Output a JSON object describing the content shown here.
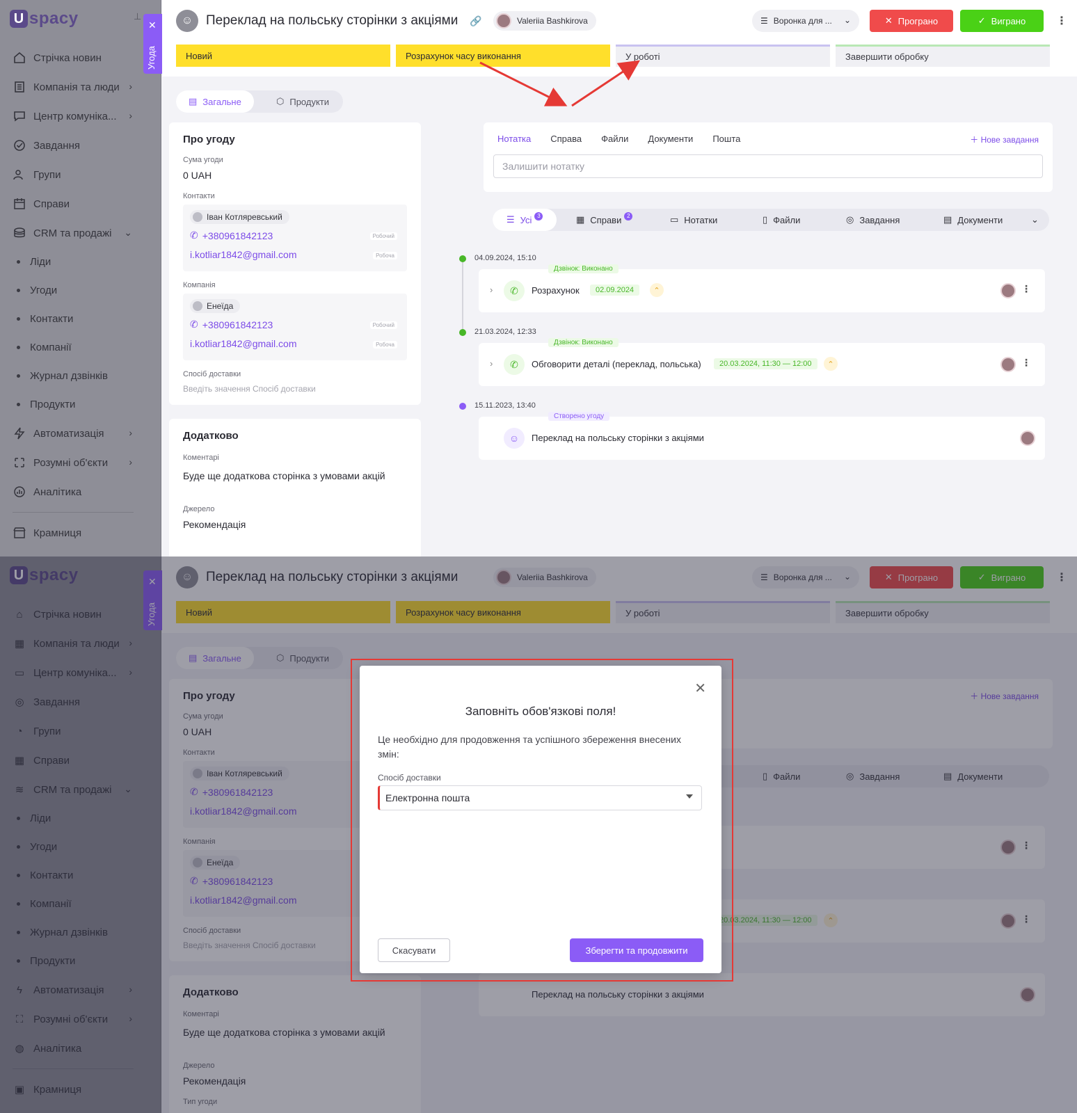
{
  "app": {
    "logo_text": "spacy",
    "logo_letter": "U",
    "accent": "#8b5cf6"
  },
  "sidebar": {
    "items": [
      {
        "label": "Стрічка новин",
        "icon": "home-icon"
      },
      {
        "label": "Компанія та люди",
        "icon": "building-icon",
        "chevron": true
      },
      {
        "label": "Центр комуніка...",
        "icon": "chat-icon",
        "chevron": true
      },
      {
        "label": "Завдання",
        "icon": "check-circle-icon"
      },
      {
        "label": "Групи",
        "icon": "users-icon"
      },
      {
        "label": "Справи",
        "icon": "calendar-icon"
      },
      {
        "label": "CRM та продажі",
        "icon": "crm-icon",
        "chevron": true
      }
    ],
    "sub_items": [
      "Ліди",
      "Угоди",
      "Контакти",
      "Компанії",
      "Журнал дзвінків",
      "Продукти"
    ],
    "bottom_items": [
      {
        "label": "Автоматизація",
        "icon": "lightning-icon",
        "chevron": true
      },
      {
        "label": "Розумні об'єкти",
        "icon": "smart-object-icon",
        "chevron": true
      },
      {
        "label": "Аналітика",
        "icon": "chart-icon"
      }
    ],
    "store": "Крамниця",
    "drawer_tab": "Угода"
  },
  "header": {
    "title": "Переклад на польську сторінки з акціями",
    "owner": "Valeriia Bashkirova",
    "funnel": "Воронка для ...",
    "lost_label": "Програно",
    "won_label": "Виграно",
    "stages": [
      "Новий",
      "Розрахунок часу виконання",
      "У роботі",
      "Завершити обробку"
    ]
  },
  "tabs": [
    "Загальне",
    "Продукти"
  ],
  "about": {
    "title": "Про угоду",
    "sum_label": "Сума угоди",
    "sum_value": "0 UAH",
    "contacts_label": "Контакти",
    "contact_name": "Іван Котляревський",
    "contact_phone": "+380961842123",
    "contact_phone_tag": "Робочий",
    "contact_email": "i.kotliar1842@gmail.com",
    "contact_email_tag": "Робоча",
    "company_label": "Компанія",
    "company_name": "Енеїда",
    "company_phone": "+380961842123",
    "company_phone_tag": "Робочий",
    "company_email": "i.kotliar1842@gmail.com",
    "company_email_tag": "Робоча",
    "delivery_label": "Спосіб доставки",
    "delivery_placeholder": "Введіть значення Спосіб доставки"
  },
  "extra": {
    "title": "Додатково",
    "comments_label": "Коментарі",
    "comments_value": "Буде ще додаткова сторінка з умовами акцій",
    "source_label": "Джерело",
    "source_value": "Рекомендація",
    "deal_type_label": "Тип угоди"
  },
  "notes": {
    "tabs": [
      "Нотатка",
      "Справа",
      "Файли",
      "Документи",
      "Пошта"
    ],
    "new_task": "Нове завдання",
    "placeholder": "Залишити нотатку"
  },
  "filters": [
    {
      "label": "Усі",
      "badge": "3"
    },
    {
      "label": "Справи",
      "badge": "2"
    },
    {
      "label": "Нотатки",
      "badge": ""
    },
    {
      "label": "Файли",
      "badge": ""
    },
    {
      "label": "Завдання",
      "badge": ""
    },
    {
      "label": "Документи",
      "badge": ""
    }
  ],
  "timeline": [
    {
      "date": "04.09.2024, 15:10",
      "tag": "Дзвінок: Виконано",
      "title": "Розрахунок",
      "chip": "02.09.2024",
      "color": "#48b728"
    },
    {
      "date": "21.03.2024, 12:33",
      "tag": "Дзвінок: Виконано",
      "title": "Обговорити деталі (переклад, польська)",
      "chip": "20.03.2024, 11:30 — 12:00",
      "color": "#48b728"
    },
    {
      "date": "15.11.2023, 13:40",
      "tag": "Створено угоду",
      "title": "Переклад на польську сторінки з акціями",
      "chip": "",
      "color": "#8b5cf6"
    }
  ],
  "modal": {
    "title": "Заповніть обов'язкові поля!",
    "description": "Це необхідно для продовження та успішного збереження внесених змін:",
    "field_label": "Спосіб доставки",
    "field_value": "Електронна пошта",
    "cancel": "Скасувати",
    "save": "Зберегти та продовжити"
  }
}
